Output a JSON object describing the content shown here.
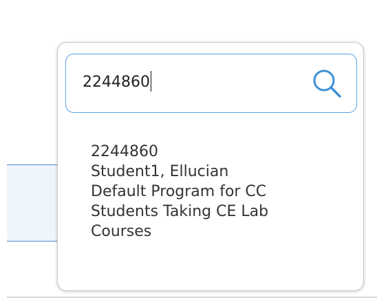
{
  "search": {
    "value": "2244860",
    "icon": "search-icon"
  },
  "results": [
    {
      "id": "2244860",
      "name": "Student1, Ellucian",
      "program_line1": "Default Program for CC",
      "program_line2": "Students Taking CE Lab",
      "program_line3": "Courses"
    }
  ],
  "colors": {
    "accent": "#5aa2e3",
    "icon": "#3f8fd6",
    "selected_row_bg": "#eef5fc",
    "selected_row_border": "#4a88d1",
    "text": "#333333"
  }
}
